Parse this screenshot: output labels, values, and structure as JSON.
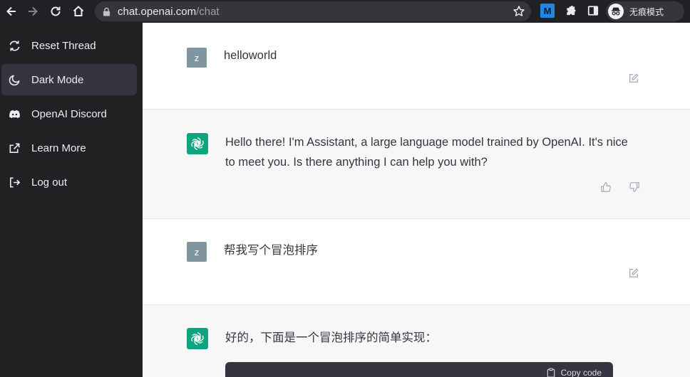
{
  "browser": {
    "url_host": "chat.openai.com",
    "url_path": "/chat",
    "extension_badge": "M",
    "profile_label": "无痕模式"
  },
  "sidebar": {
    "items": [
      {
        "label": "Reset Thread",
        "icon": "refresh-icon"
      },
      {
        "label": "Dark Mode",
        "icon": "moon-icon"
      },
      {
        "label": "OpenAI Discord",
        "icon": "discord-icon"
      },
      {
        "label": "Learn More",
        "icon": "external-link-icon"
      },
      {
        "label": "Log out",
        "icon": "logout-icon"
      }
    ]
  },
  "conversation": {
    "messages": [
      {
        "role": "user",
        "avatar": "z",
        "text": "helloworld"
      },
      {
        "role": "assistant",
        "text": "Hello there! I'm Assistant, a large language model trained by OpenAI. It's nice to meet you. Is there anything I can help you with?"
      },
      {
        "role": "user",
        "avatar": "z",
        "text": "帮我写个冒泡排序"
      },
      {
        "role": "assistant",
        "text": "好的，下面是一个冒泡排序的简单实现：",
        "code_action": "Copy code"
      }
    ]
  },
  "colors": {
    "sidebar_bg": "#202123",
    "active_item_bg": "#343541",
    "openai_green": "#10a37f",
    "user_avatar_bg": "#7f959f",
    "assistant_row_bg": "#f7f7f8"
  }
}
